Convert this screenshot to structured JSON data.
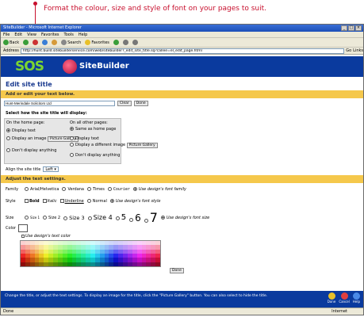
{
  "callout": "Format the colour, size and style of font on your pages to suit.",
  "window": {
    "title": "SiteBuilder - Microsoft Internet Explorer"
  },
  "menu": [
    "File",
    "Edit",
    "View",
    "Favorites",
    "Tools",
    "Help"
  ],
  "toolbar": {
    "back": "Back",
    "search": "Search",
    "favorites": "Favorites",
    "links": "Links"
  },
  "address": {
    "label": "Address",
    "url": "http://hunt.build.sitebuilderservice.com/web/sitebuilder?_edit_site_title.sq?callee=el_edit_page.html",
    "go": "Go"
  },
  "banner": {
    "logo": "SOS",
    "brand": "SiteBuilder"
  },
  "page_title": "Edit site title",
  "section1": "Add or edit your text below.",
  "title_input": "Hunt-Merindale Solicitors Ltd",
  "clear_btn": "Clear",
  "done_btn": "Done",
  "select_label": "Select how the site title will display:",
  "home": {
    "head": "On the home page:",
    "opt1": "Display text",
    "opt2": "Display an image",
    "opt3": "Don't display anything",
    "gallery": "Picture Gallery"
  },
  "other": {
    "head": "On all other pages:",
    "opt1": "Same as home page",
    "opt2": "Display text",
    "opt3": "Display a different image",
    "opt4": "Don't display anything",
    "gallery": "Picture Gallery"
  },
  "align": {
    "label": "Align the site title",
    "value": "Left"
  },
  "section2": "Adjust the text settings.",
  "family": {
    "label": "Family",
    "opts": [
      "Arial/Helvetica",
      "Verdana",
      "Times",
      "Courier",
      "Use design's font family"
    ]
  },
  "style": {
    "label": "Style",
    "opts": [
      "Bold",
      "Italic",
      "Underline",
      "Normal",
      "Use design's font style"
    ]
  },
  "size": {
    "label": "Size",
    "opts": [
      "Size 1",
      "Size 2",
      "Size 3",
      "Size 4",
      "5",
      "6",
      "7",
      "Use design's font size"
    ]
  },
  "color": {
    "label": "Color",
    "use": "Use design's text color"
  },
  "done2": "Done",
  "footer": {
    "text": "Change the title, or adjust the text settings. To display an image for the title, click the \"Picture Gallery\" button. You can also select to hide the title.",
    "done": "Done",
    "cancel": "Cancel",
    "help": "Help"
  },
  "status": {
    "left": "Done",
    "zone": "Internet"
  },
  "colors": {
    "banner": "#0a3a9e",
    "section": "#f5c84c",
    "title": "#1a3a8f",
    "callout": "#c8102e"
  }
}
